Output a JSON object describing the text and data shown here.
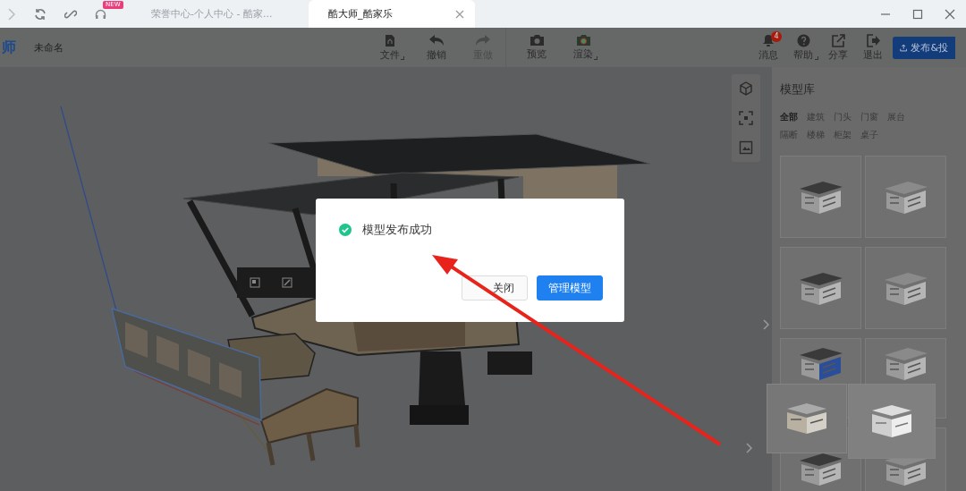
{
  "browser": {
    "new_badge": "NEW",
    "tabs": [
      {
        "title": "荣誉中心-个人中心 - 酷家...",
        "selected": false
      },
      {
        "title": "酷大师_酷家乐",
        "selected": true
      }
    ]
  },
  "toolbar": {
    "logo": "师",
    "file_name": "未命名",
    "center_buttons": [
      {
        "kind": "file",
        "label": "文件",
        "menu": true,
        "disabled": false
      },
      {
        "kind": "undo",
        "label": "撤销",
        "menu": false,
        "disabled": false
      },
      {
        "kind": "redo",
        "label": "重做",
        "menu": false,
        "disabled": true
      },
      {
        "kind": "camera",
        "label": "预览",
        "menu": false,
        "disabled": false
      },
      {
        "kind": "render",
        "label": "渲染",
        "menu": true,
        "disabled": false
      }
    ],
    "right_buttons": [
      {
        "kind": "bell",
        "label": "消息",
        "menu": false,
        "badge": "4"
      },
      {
        "kind": "help",
        "label": "帮助",
        "menu": true
      },
      {
        "kind": "share",
        "label": "分享",
        "menu": false
      },
      {
        "kind": "exit",
        "label": "退出",
        "menu": false
      }
    ],
    "publish_button": "发布&投"
  },
  "library": {
    "title": "模型库",
    "categories": [
      {
        "label": "全部",
        "selected": true
      },
      {
        "label": "建筑",
        "selected": false
      },
      {
        "label": "门头",
        "selected": false
      },
      {
        "label": "门窗",
        "selected": false
      },
      {
        "label": "展台",
        "selected": false
      },
      {
        "label": "隔断",
        "selected": false
      },
      {
        "label": "楼梯",
        "selected": false
      },
      {
        "label": "柜架",
        "selected": false
      },
      {
        "label": "桌子",
        "selected": false
      }
    ]
  },
  "dialog": {
    "message": "模型发布成功",
    "buttons": [
      {
        "label": "关闭",
        "primary": false
      },
      {
        "label": "管理模型",
        "primary": true
      }
    ]
  }
}
